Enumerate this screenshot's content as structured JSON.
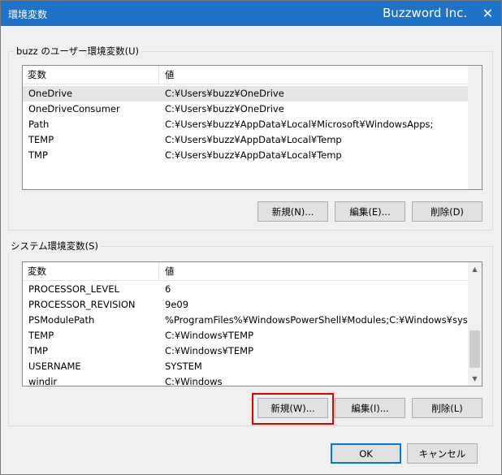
{
  "window": {
    "title": "環境変数",
    "brand": "Buzzword Inc.",
    "close_glyph": "✕"
  },
  "user_vars": {
    "group_label": "buzz のユーザー環境変数(U)",
    "headers": {
      "name": "変数",
      "value": "値"
    },
    "rows": [
      {
        "name": "OneDrive",
        "value": "C:¥Users¥buzz¥OneDrive",
        "selected": true
      },
      {
        "name": "OneDriveConsumer",
        "value": "C:¥Users¥buzz¥OneDrive"
      },
      {
        "name": "Path",
        "value": "C:¥Users¥buzz¥AppData¥Local¥Microsoft¥WindowsApps;"
      },
      {
        "name": "TEMP",
        "value": "C:¥Users¥buzz¥AppData¥Local¥Temp"
      },
      {
        "name": "TMP",
        "value": "C:¥Users¥buzz¥AppData¥Local¥Temp"
      }
    ],
    "buttons": {
      "new": "新規(N)...",
      "edit": "編集(E)...",
      "delete": "削除(D)"
    }
  },
  "system_vars": {
    "group_label": "システム環境変数(S)",
    "headers": {
      "name": "変数",
      "value": "値"
    },
    "rows": [
      {
        "name": "PROCESSOR_LEVEL",
        "value": "6"
      },
      {
        "name": "PROCESSOR_REVISION",
        "value": "9e09"
      },
      {
        "name": "PSModulePath",
        "value": "%ProgramFiles%¥WindowsPowerShell¥Modules;C:¥Windows¥syste..."
      },
      {
        "name": "TEMP",
        "value": "C:¥Windows¥TEMP"
      },
      {
        "name": "TMP",
        "value": "C:¥Windows¥TEMP"
      },
      {
        "name": "USERNAME",
        "value": "SYSTEM"
      },
      {
        "name": "windir",
        "value": "C:¥Windows"
      }
    ],
    "buttons": {
      "new": "新規(W)...",
      "edit": "編集(I)...",
      "delete": "削除(L)"
    },
    "highlighted_button": "new"
  },
  "footer": {
    "ok": "OK",
    "cancel": "キャンセル"
  },
  "colors": {
    "titlebar": "#1e72c8",
    "highlight": "#e00000",
    "selected_row": "#e5e5e5"
  }
}
